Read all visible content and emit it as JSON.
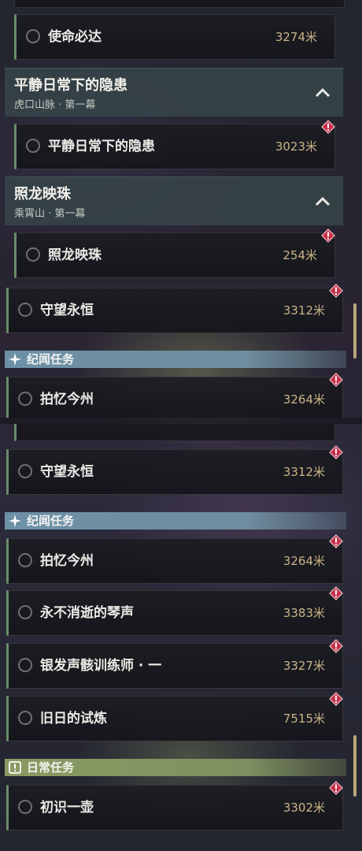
{
  "top_panel": {
    "tasks": [
      {
        "name": "使命必达",
        "distance": "3274米"
      }
    ],
    "chapters": [
      {
        "title": "平静日常下的隐患",
        "subtitle": "虎口山脉 · 第一幕",
        "task": {
          "name": "平静日常下的隐患",
          "distance": "3023米"
        }
      },
      {
        "title": "照龙映珠",
        "subtitle": "乘霄山 · 第一幕",
        "task": {
          "name": "照龙映珠",
          "distance": "254米"
        }
      }
    ],
    "standalone": {
      "name": "守望永恒",
      "distance": "3312米"
    },
    "section": {
      "label": "纪闻任务"
    },
    "section_task": {
      "name": "拍忆今州",
      "distance": "3264米"
    }
  },
  "bottom_panel": {
    "standalone": {
      "name": "守望永恒",
      "distance": "3312米"
    },
    "section_story": {
      "label": "纪闻任务",
      "tasks": [
        {
          "name": "拍忆今州",
          "distance": "3264米"
        },
        {
          "name": "永不消逝的琴声",
          "distance": "3383米"
        },
        {
          "name": "银发声骸训练师 · 一",
          "distance": "3327米"
        },
        {
          "name": "旧日的试炼",
          "distance": "7515米"
        }
      ]
    },
    "section_daily": {
      "label": "日常任务",
      "tasks": [
        {
          "name": "初识一壶",
          "distance": "3302米"
        }
      ]
    }
  },
  "colors": {
    "distance": "#c9b487",
    "alert": "#d23a55",
    "section_story": "#6d90a6",
    "section_daily": "#8a9b62",
    "row_accent": "#6a8d6a"
  }
}
